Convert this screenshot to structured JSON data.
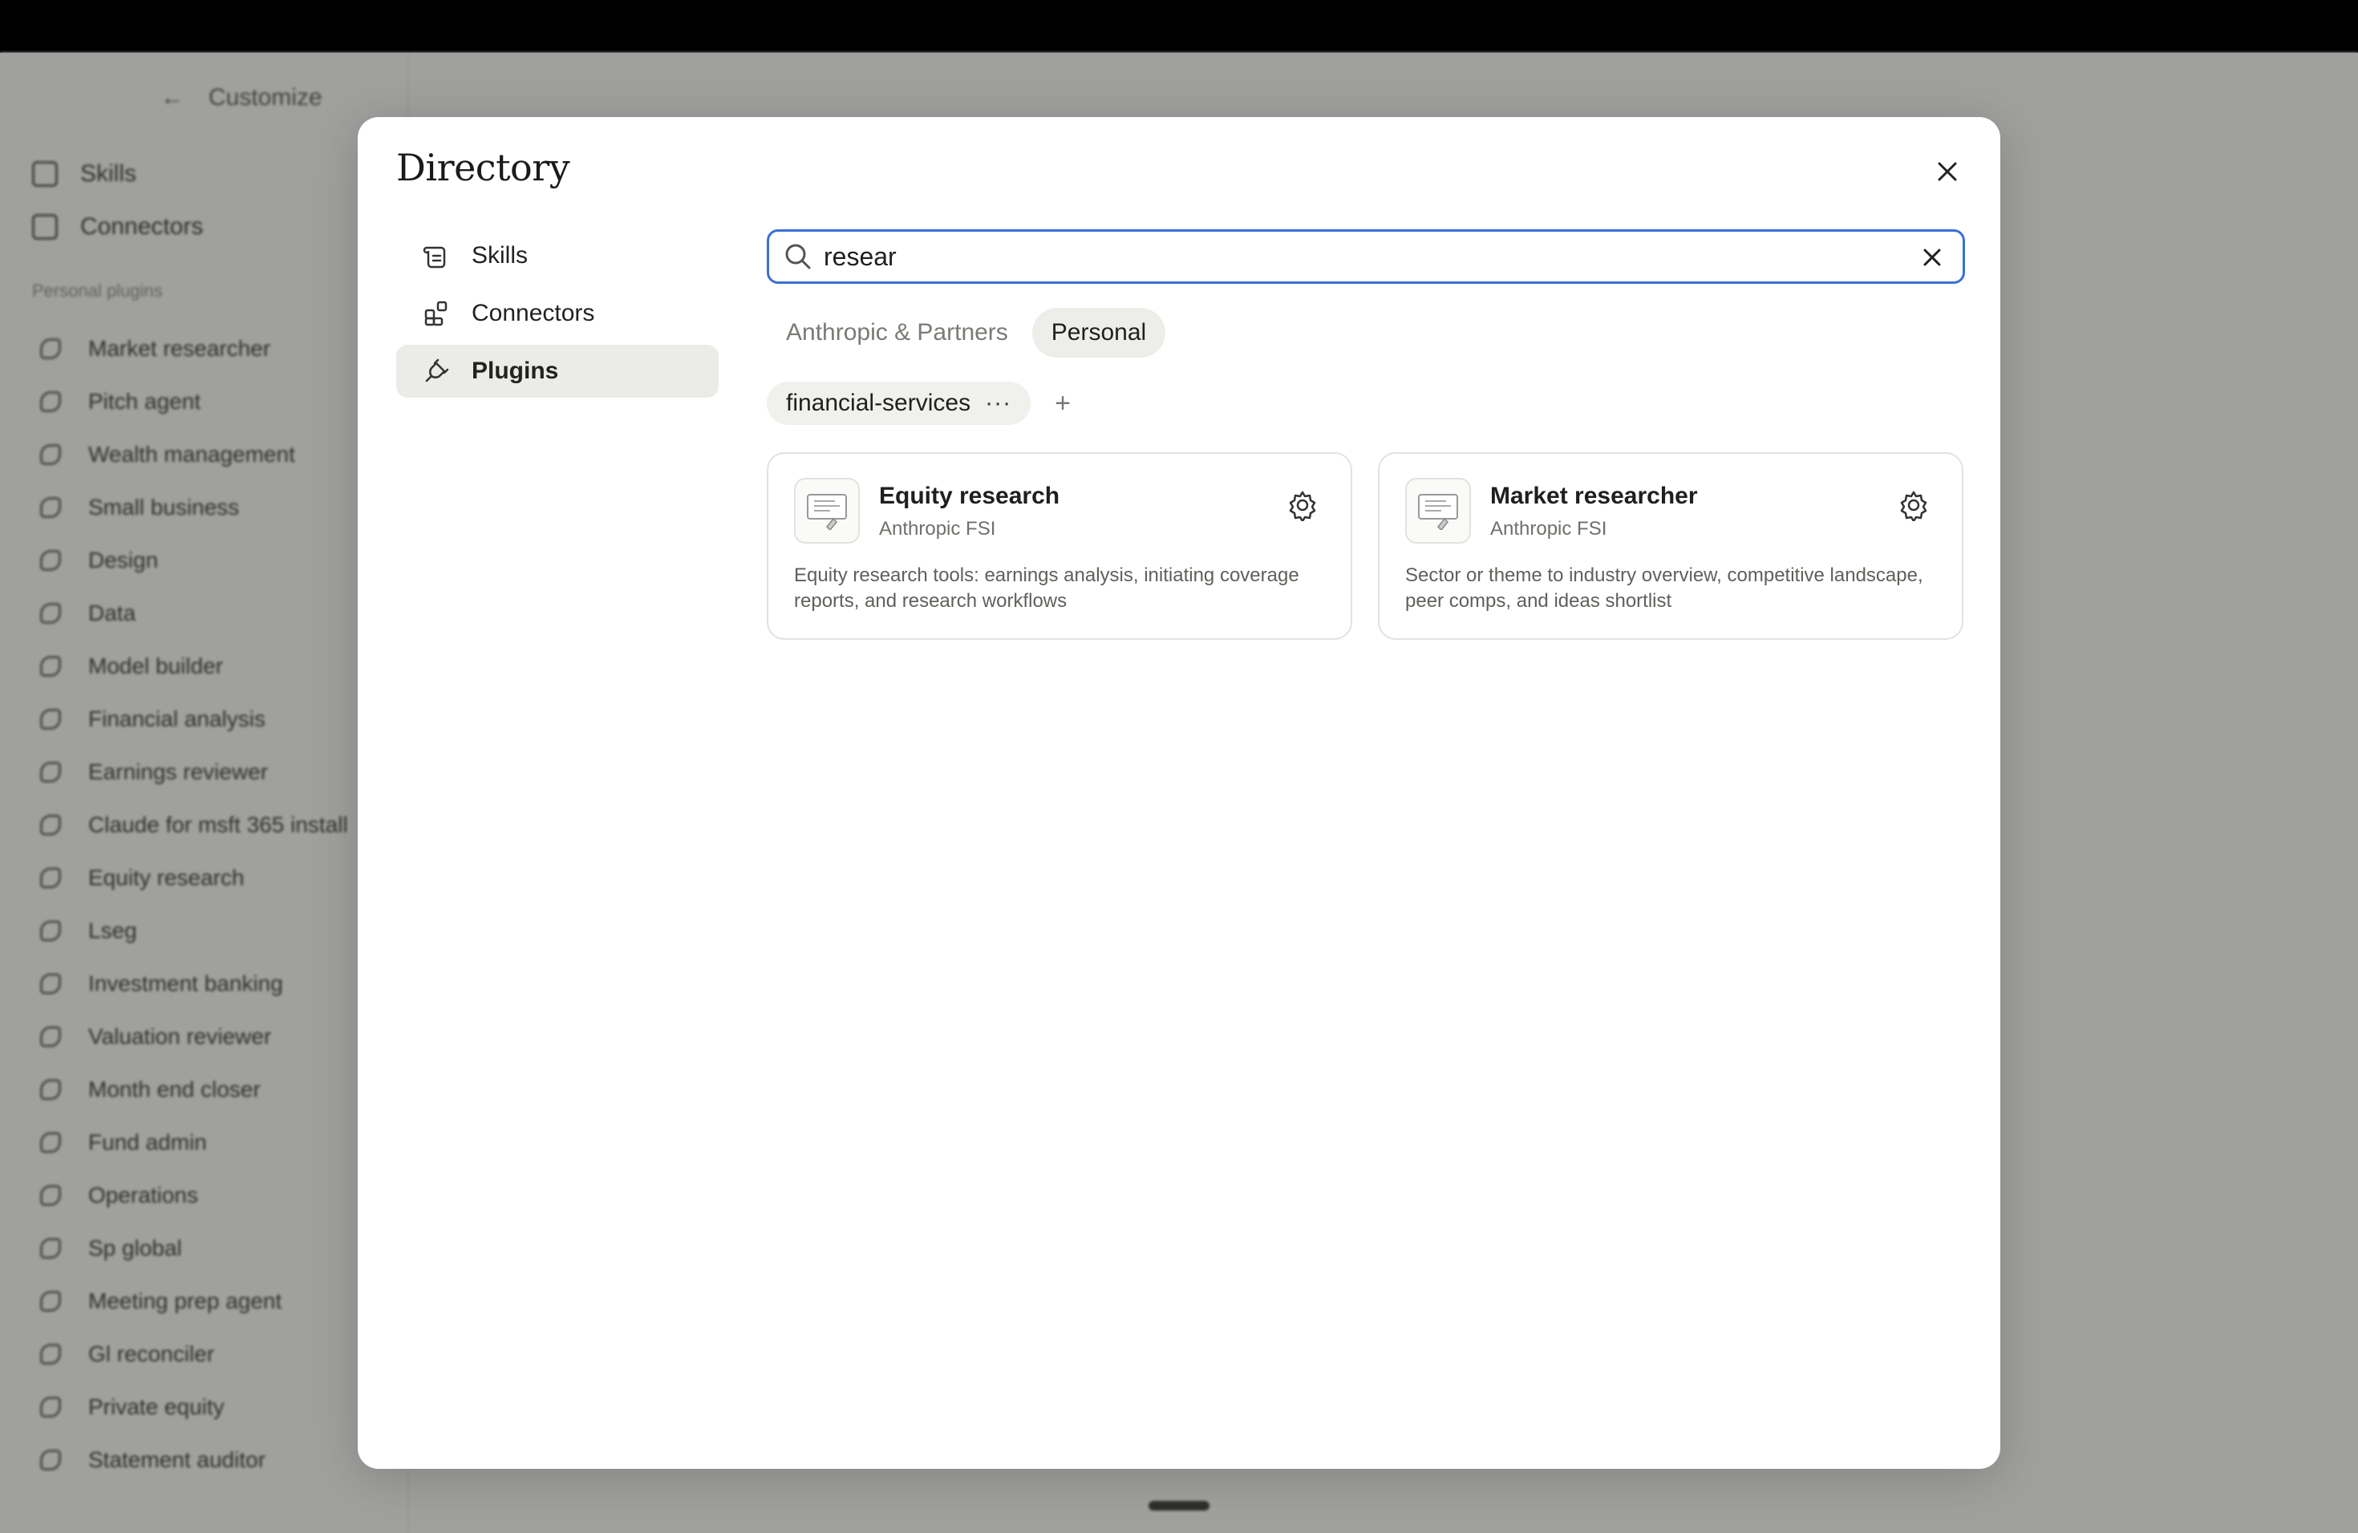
{
  "background": {
    "header": {
      "back_label": "Customize"
    },
    "nav": [
      {
        "label": "Skills"
      },
      {
        "label": "Connectors"
      }
    ],
    "section_label": "Personal plugins",
    "plugins": [
      "Market researcher",
      "Pitch agent",
      "Wealth management",
      "Small business",
      "Design",
      "Data",
      "Model builder",
      "Financial analysis",
      "Earnings reviewer",
      "Claude for msft 365 install",
      "Equity research",
      "Lseg",
      "Investment banking",
      "Valuation reviewer",
      "Month end closer",
      "Fund admin",
      "Operations",
      "Sp global",
      "Meeting prep agent",
      "Gl reconciler",
      "Private equity",
      "Statement auditor"
    ]
  },
  "modal": {
    "title": "Directory",
    "nav": [
      {
        "label": "Skills",
        "icon": "skills-icon"
      },
      {
        "label": "Connectors",
        "icon": "connectors-icon"
      },
      {
        "label": "Plugins",
        "icon": "plug-icon",
        "active": true
      }
    ],
    "search": {
      "value": "resear",
      "placeholder": "Search"
    },
    "tabs": [
      {
        "label": "Anthropic & Partners",
        "active": false
      },
      {
        "label": "Personal",
        "active": true
      }
    ],
    "chip": {
      "label": "financial-services",
      "more_label": "···",
      "add_label": "+"
    },
    "cards": [
      {
        "name": "Equity research",
        "vendor": "Anthropic FSI",
        "description": "Equity research tools: earnings analysis, initiating coverage reports, and research workflows"
      },
      {
        "name": "Market researcher",
        "vendor": "Anthropic FSI",
        "description": "Sector or theme to industry overview, competitive landscape, peer comps, and ideas shortlist"
      }
    ]
  },
  "colors": {
    "accent": "#3b6fd4",
    "overlay": "rgba(40,40,38,0.42)",
    "active_nav": "#ebebe8"
  }
}
